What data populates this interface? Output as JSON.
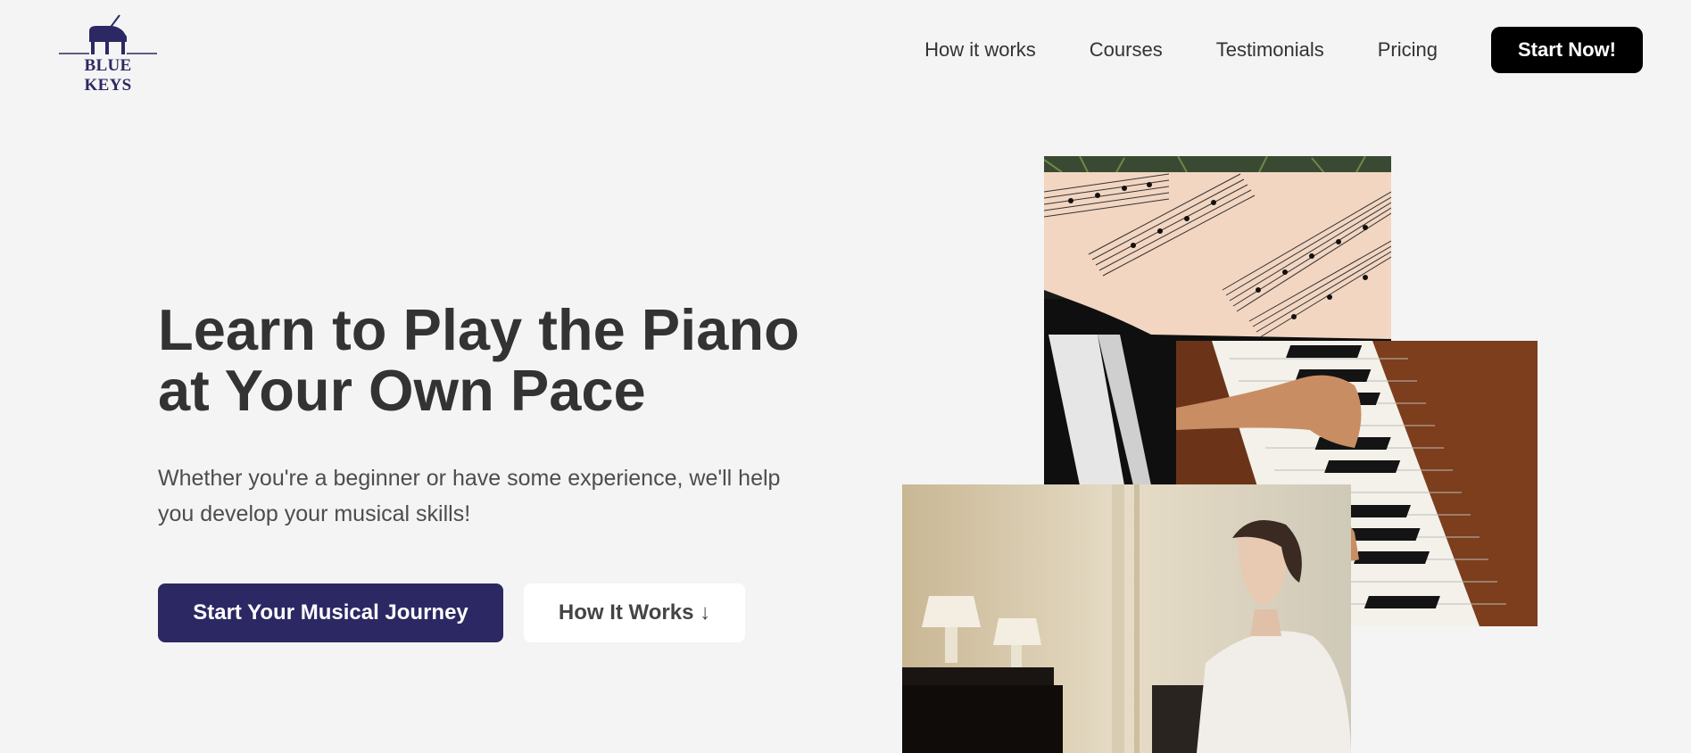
{
  "header": {
    "logo_text": "BLUE KEYS",
    "nav": [
      {
        "label": "How it works"
      },
      {
        "label": "Courses"
      },
      {
        "label": "Testimonials"
      },
      {
        "label": "Pricing"
      }
    ],
    "cta_label": "Start Now!"
  },
  "hero": {
    "title": "Learn to Play the Piano at Your Own Pace",
    "subtitle": "Whether you're a beginner or have some experience, we'll help you develop your musical skills!",
    "primary_button": "Start Your Musical Journey",
    "secondary_button": "How It Works ↓"
  },
  "colors": {
    "brand": "#2c2863",
    "background": "#f4f4f4",
    "text": "#333333",
    "cta": "#000000"
  },
  "icons": [
    "grand-piano-icon"
  ]
}
